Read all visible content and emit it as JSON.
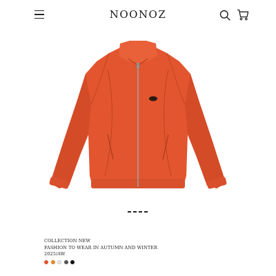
{
  "header": {
    "brand": "NOONOZ",
    "menu_icon": "menu-icon",
    "search_icon": "search-icon",
    "cart_icon": "cart-icon"
  },
  "product": {
    "image_icon": "orange-zip-jacket",
    "main_color": "#e2552f"
  },
  "pager": {
    "count": 4
  },
  "collection": {
    "line1": "COLLECTION NEW",
    "line2": "FASHION TO WEAR IN AUTUMN AND WINTER",
    "line3": "2025/AW"
  },
  "swatches": [
    "#e2552f",
    "#d98a2e",
    "#e6e6e6",
    "#555555",
    "#151515"
  ]
}
